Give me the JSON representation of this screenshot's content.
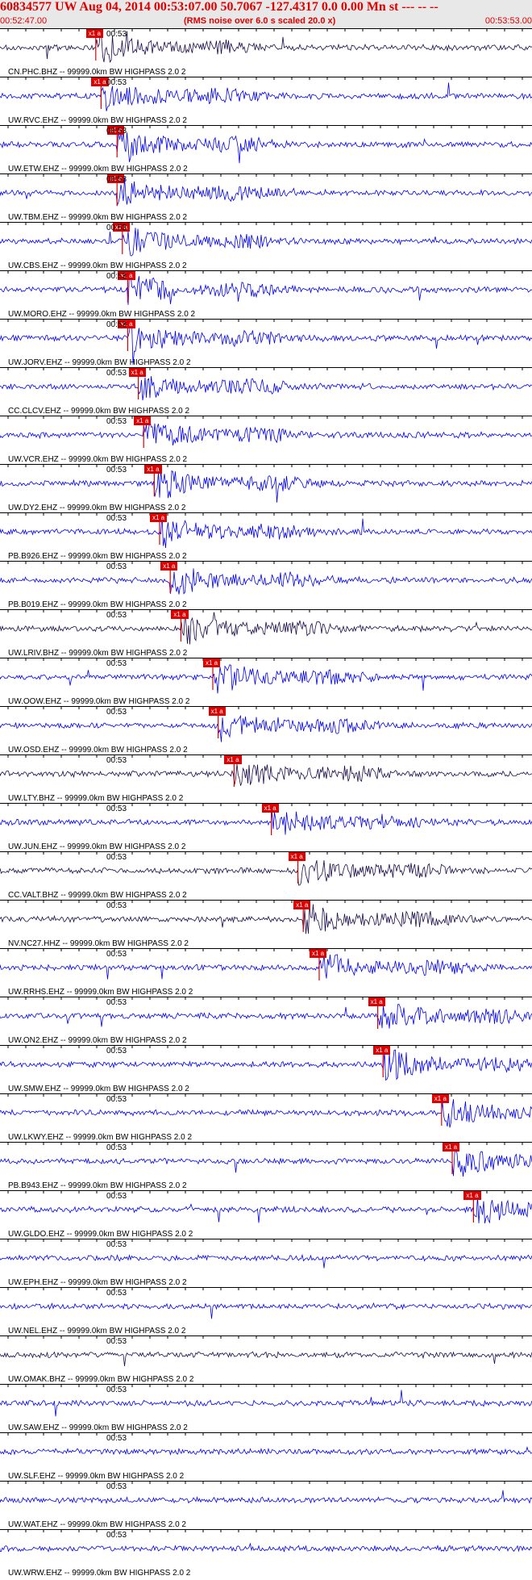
{
  "header": {
    "title": "60834577 UW Aug 04, 2014 00:53:07.00   50.7067 -127.4317  0.0 0.00 Mn st --- -- --",
    "start_time": "00:52:47.00",
    "note": "(RMS noise over 6.0 s scaled 20.0 x)",
    "end_time": "00:53:53.00"
  },
  "colors": {
    "header_text": "#e00000",
    "trace_blue": "#0000ee",
    "trace_dark": "#1a0a4a",
    "pick_red": "#dd0000",
    "axis": "#000000"
  },
  "tick_label": "00:53",
  "pick_label": "x1 a",
  "stations": [
    {
      "label": "CN.PHC.BHZ -- 99999.0km BW  HIGHPASS  2.0  2",
      "pick": 0.18,
      "color": "dark"
    },
    {
      "label": "UW.RVC.EHZ -- 99999.0km BW  HIGHPASS  2.0  2",
      "pick": 0.19,
      "color": "blue"
    },
    {
      "label": "UW.ETW.EHZ -- 99999.0km BW  HIGHPASS  2.0  2",
      "pick": 0.22,
      "color": "blue"
    },
    {
      "label": "UW.TBM.EHZ -- 99999.0km BW  HIGHPASS  2.0  2",
      "pick": 0.22,
      "color": "blue"
    },
    {
      "label": "UW.CBS.EHZ -- 99999.0km BW  HIGHPASS  2.0  2",
      "pick": 0.23,
      "color": "blue"
    },
    {
      "label": "UW.MORO.EHZ -- 99999.0km BW  HIGHPASS  2.0  2",
      "pick": 0.24,
      "color": "blue"
    },
    {
      "label": "UW.JORV.EHZ -- 99999.0km BW  HIGHPASS  2.0  2",
      "pick": 0.24,
      "color": "blue"
    },
    {
      "label": "CC.CLCV.EHZ -- 99999.0km BW  HIGHPASS  2.0  2",
      "pick": 0.26,
      "color": "blue"
    },
    {
      "label": "UW.VCR.EHZ -- 99999.0km BW  HIGHPASS  2.0  2",
      "pick": 0.27,
      "color": "blue"
    },
    {
      "label": "UW.DY2.EHZ -- 99999.0km BW  HIGHPASS  2.0  2",
      "pick": 0.29,
      "color": "blue"
    },
    {
      "label": "PB.B926.EHZ -- 99999.0km BW  HIGHPASS  2.0  2",
      "pick": 0.3,
      "color": "blue"
    },
    {
      "label": "PB.B019.EHZ -- 99999.0km BW  HIGHPASS  2.0  2",
      "pick": 0.32,
      "color": "blue"
    },
    {
      "label": "UW.LRIV.BHZ -- 99999.0km BW  HIGHPASS  2.0  2",
      "pick": 0.34,
      "color": "dark"
    },
    {
      "label": "UW.OOW.EHZ -- 99999.0km BW  HIGHPASS  2.0  2",
      "pick": 0.4,
      "color": "blue"
    },
    {
      "label": "UW.OSD.EHZ -- 99999.0km BW  HIGHPASS  2.0  2",
      "pick": 0.41,
      "color": "blue"
    },
    {
      "label": "UW.LTY.BHZ -- 99999.0km BW  HIGHPASS  2.0  2",
      "pick": 0.44,
      "color": "dark"
    },
    {
      "label": "UW.JUN.EHZ -- 99999.0km BW  HIGHPASS  2.0  2",
      "pick": 0.51,
      "color": "blue"
    },
    {
      "label": "CC.VALT.BHZ -- 99999.0km BW  HIGHPASS  2.0  2",
      "pick": 0.56,
      "color": "dark"
    },
    {
      "label": "NV.NC27.HHZ -- 99999.0km BW  HIGHPASS  2.0  2",
      "pick": 0.57,
      "color": "dark"
    },
    {
      "label": "UW.RRHS.EHZ -- 99999.0km BW  HIGHPASS  2.0  2",
      "pick": 0.6,
      "color": "blue"
    },
    {
      "label": "UW.ON2.EHZ -- 99999.0km BW  HIGHPASS  2.0  2",
      "pick": 0.71,
      "color": "blue"
    },
    {
      "label": "UW.SMW.EHZ -- 99999.0km BW  HIGHPASS  2.0  2",
      "pick": 0.72,
      "color": "blue"
    },
    {
      "label": "UW.LKWY.EHZ -- 99999.0km BW  HIGHPASS  2.0  2",
      "pick": 0.83,
      "color": "blue"
    },
    {
      "label": "PB.B943.EHZ -- 99999.0km BW  HIGHPASS  2.0  2",
      "pick": 0.85,
      "color": "blue"
    },
    {
      "label": "UW.GLDO.EHZ -- 99999.0km BW  HIGHPASS  2.0  2",
      "pick": 0.89,
      "color": "blue"
    },
    {
      "label": "UW.EPH.EHZ -- 99999.0km BW  HIGHPASS  2.0  2",
      "pick": null,
      "color": "blue"
    },
    {
      "label": "UW.NEL.EHZ -- 99999.0km BW  HIGHPASS  2.0  2",
      "pick": null,
      "color": "blue"
    },
    {
      "label": "UW.OMAK.BHZ -- 99999.0km BW  HIGHPASS  2.0  2",
      "pick": null,
      "color": "dark"
    },
    {
      "label": "UW.SAW.EHZ -- 99999.0km BW  HIGHPASS  2.0  2",
      "pick": null,
      "color": "blue"
    },
    {
      "label": "UW.SLF.EHZ -- 99999.0km BW  HIGHPASS  2.0  2",
      "pick": null,
      "color": "blue"
    },
    {
      "label": "UW.WAT.EHZ -- 99999.0km BW  HIGHPASS  2.0  2",
      "pick": null,
      "color": "blue"
    },
    {
      "label": "UW.WRW.EHZ -- 99999.0km BW  HIGHPASS  2.0  2",
      "pick": null,
      "color": "blue"
    }
  ]
}
